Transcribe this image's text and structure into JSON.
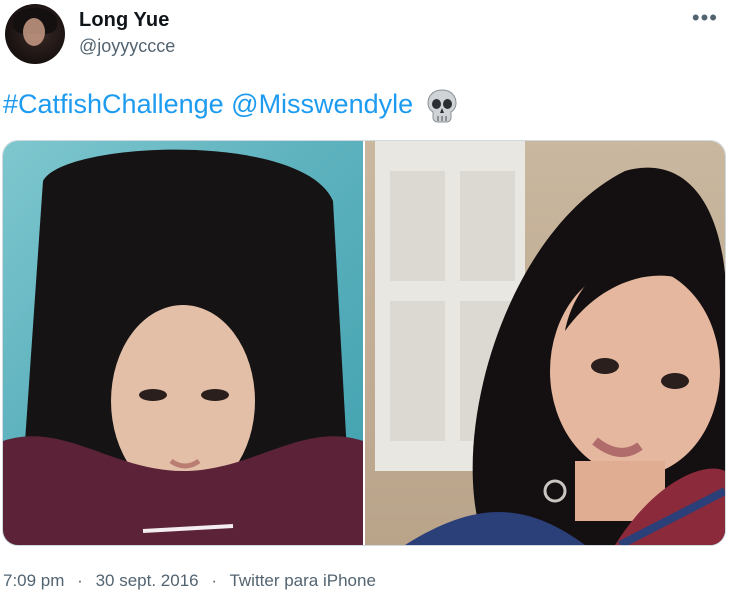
{
  "author": {
    "name": "Long Yue",
    "handle": "@joyyyccce"
  },
  "more_icon": "three-dots-horizontal",
  "more_glyph": "•••",
  "tweet": {
    "hashtag": "#CatfishChallenge",
    "mention": "@Misswendyle",
    "emoji": "skull"
  },
  "media": [
    {
      "alt": "selfie-without-makeup"
    },
    {
      "alt": "selfie-with-makeup"
    }
  ],
  "footer": {
    "time": "7:09 pm",
    "date": "30 sept. 2016",
    "separator": "·",
    "source": "Twitter para iPhone"
  },
  "colors": {
    "link": "#1d9bf0",
    "secondary_text": "#536471",
    "primary_text": "#0f1419"
  }
}
